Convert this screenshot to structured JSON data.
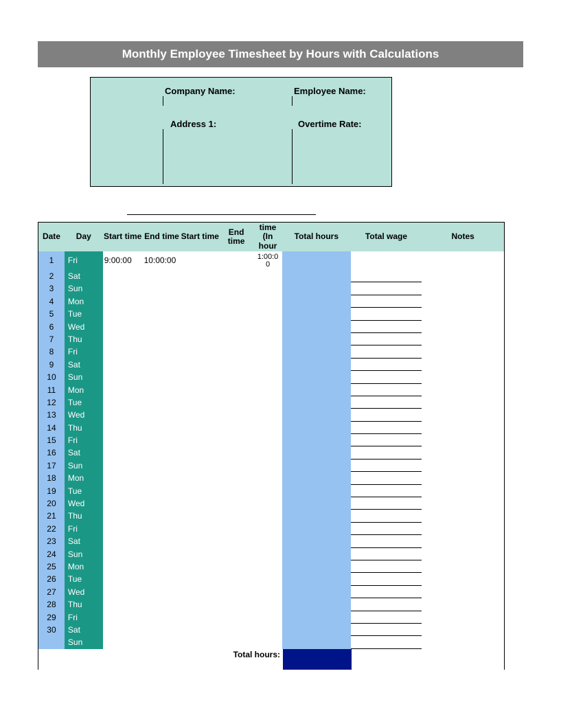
{
  "title": "Monthly Employee Timesheet by Hours with Calculations",
  "info": {
    "company_label": "Company Name:",
    "employee_label": "Employee Name:",
    "address_label": "Address 1:",
    "overtime_label": "Overtime Rate:"
  },
  "headers": {
    "date": "Date",
    "day": "Day",
    "start1": "Start time",
    "end1": "End time",
    "start2": "Start time",
    "end2": "End time",
    "time": "time (In hour",
    "total": "Total hours",
    "wage": "Total wage",
    "notes": "Notes"
  },
  "rows": [
    {
      "date": "1",
      "day": "Fri",
      "start": "9:00:00",
      "end": "10:00:00",
      "time": "1:00:00"
    },
    {
      "date": "2",
      "day": "Sat"
    },
    {
      "date": "3",
      "day": "Sun"
    },
    {
      "date": "4",
      "day": "Mon"
    },
    {
      "date": "5",
      "day": "Tue"
    },
    {
      "date": "6",
      "day": "Wed"
    },
    {
      "date": "7",
      "day": "Thu"
    },
    {
      "date": "8",
      "day": "Fri"
    },
    {
      "date": "9",
      "day": "Sat"
    },
    {
      "date": "10",
      "day": "Sun"
    },
    {
      "date": "11",
      "day": "Mon"
    },
    {
      "date": "12",
      "day": "Tue"
    },
    {
      "date": "13",
      "day": "Wed"
    },
    {
      "date": "14",
      "day": "Thu"
    },
    {
      "date": "15",
      "day": "Fri"
    },
    {
      "date": "16",
      "day": "Sat"
    },
    {
      "date": "17",
      "day": "Sun"
    },
    {
      "date": "18",
      "day": "Mon"
    },
    {
      "date": "19",
      "day": "Tue"
    },
    {
      "date": "20",
      "day": "Wed"
    },
    {
      "date": "21",
      "day": "Thu"
    },
    {
      "date": "22",
      "day": "Fri"
    },
    {
      "date": "23",
      "day": "Sat"
    },
    {
      "date": "24",
      "day": "Sun"
    },
    {
      "date": "25",
      "day": "Mon"
    },
    {
      "date": "26",
      "day": "Tue"
    },
    {
      "date": "27",
      "day": "Wed"
    },
    {
      "date": "28",
      "day": "Thu"
    },
    {
      "date": "29",
      "day": "Fri"
    },
    {
      "date": "30",
      "day": "Sat"
    },
    {
      "date": "",
      "day": "Sun"
    }
  ],
  "footer": {
    "total_label": "Total hours:"
  }
}
